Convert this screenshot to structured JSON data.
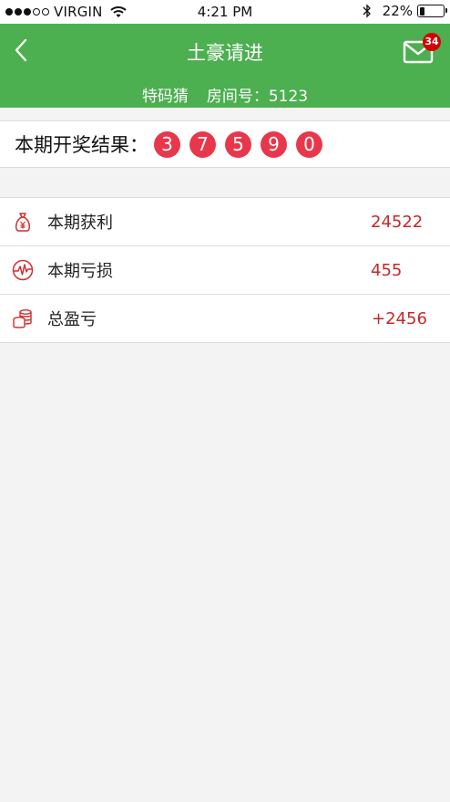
{
  "status_bar": {
    "carrier": "VIRGIN",
    "signal_dots_filled": 3,
    "signal_dots_total": 5,
    "time": "4:21 PM",
    "battery_pct": "22%",
    "battery_level": 0.22
  },
  "header": {
    "title": "土豪请进",
    "game_name": "特码猜",
    "room_label": "房间号：5123",
    "mail_badge": "34",
    "color": "#4caf50"
  },
  "result": {
    "label": "本期开奖结果：",
    "numbers": [
      "3",
      "7",
      "5",
      "9",
      "0"
    ],
    "ball_color": "#e8374b"
  },
  "stats": [
    {
      "icon": "money-bag-icon",
      "label": "本期获利",
      "value": "24522"
    },
    {
      "icon": "pulse-icon",
      "label": "本期亏损",
      "value": "455"
    },
    {
      "icon": "coins-icon",
      "label": "总盈亏",
      "value": "+2456"
    }
  ],
  "accent_red": "#c62828"
}
